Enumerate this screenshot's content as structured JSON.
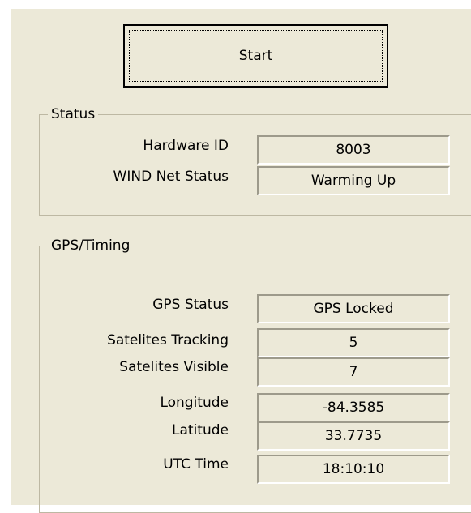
{
  "start_button": {
    "label": "Start"
  },
  "status": {
    "title": "Status",
    "hardware_id": {
      "label": "Hardware ID",
      "value": "8003"
    },
    "wind_net_status": {
      "label": "WIND Net Status",
      "value": "Warming Up"
    }
  },
  "gps": {
    "title": "GPS/Timing",
    "gps_status": {
      "label": "GPS Status",
      "value": "GPS Locked"
    },
    "satellites_tracking": {
      "label": "Satelites Tracking",
      "value": "5"
    },
    "satellites_visible": {
      "label": "Satelites Visible",
      "value": "7"
    },
    "longitude": {
      "label": "Longitude",
      "value": "-84.3585"
    },
    "latitude": {
      "label": "Latitude",
      "value": "33.7735"
    },
    "utc_time": {
      "label": "UTC Time",
      "value": "18:10:10"
    }
  },
  "colors": {
    "panel_background": "#ece9d8",
    "group_border": "#bdb8a3"
  }
}
